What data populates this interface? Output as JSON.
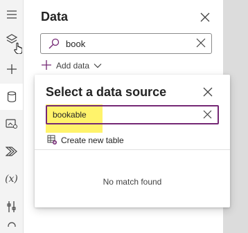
{
  "rail": {
    "items": [
      {
        "icon": "hamburger-menu-icon"
      },
      {
        "icon": "layers-icon"
      },
      {
        "icon": "plus-icon"
      },
      {
        "icon": "database-icon",
        "active": true
      },
      {
        "icon": "media-icon"
      },
      {
        "icon": "power-automate-icon"
      },
      {
        "icon": "variables-icon",
        "text": "(x)"
      },
      {
        "icon": "tools-icon"
      },
      {
        "icon": "search-icon"
      }
    ]
  },
  "data_panel": {
    "title": "Data",
    "search": {
      "value": "book"
    },
    "add_data_label": "Add data"
  },
  "popup": {
    "title": "Select a data source",
    "search": {
      "value": "bookable"
    },
    "create_table_label": "Create new table",
    "empty_message": "No match found"
  },
  "colors": {
    "accent": "#742774",
    "highlight": "#fff36b",
    "rail_bg": "#f3f3f3",
    "gutter_bg": "#dcdcdc"
  }
}
